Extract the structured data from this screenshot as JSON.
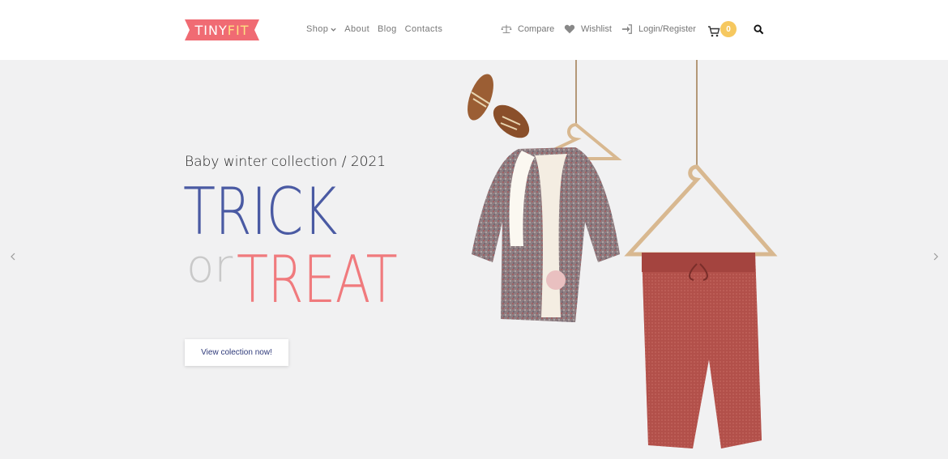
{
  "brand": {
    "logo_part1": "TINY",
    "logo_part2": "FIT",
    "logo_color": "#f06b73"
  },
  "nav": {
    "items": [
      "Shop",
      "About",
      "Blog",
      "Contacts"
    ]
  },
  "utilities": {
    "compare": "Compare",
    "wishlist": "Wishlist",
    "login": "Login/Register",
    "cart_count": "0"
  },
  "hero": {
    "subtitle": "Baby winter collection / 2021",
    "headline_1": "TRICK",
    "headline_or": "or",
    "headline_2": "TREAT",
    "cta": "View colection now!",
    "colors": {
      "trick": "#4a5aa3",
      "or": "#c9c9c9",
      "treat": "#f07a7d"
    }
  },
  "icons": [
    "compare-icon",
    "heart-icon",
    "login-icon",
    "cart-icon",
    "search-icon",
    "chevron-left-icon",
    "chevron-right-icon",
    "chevron-down-icon"
  ]
}
